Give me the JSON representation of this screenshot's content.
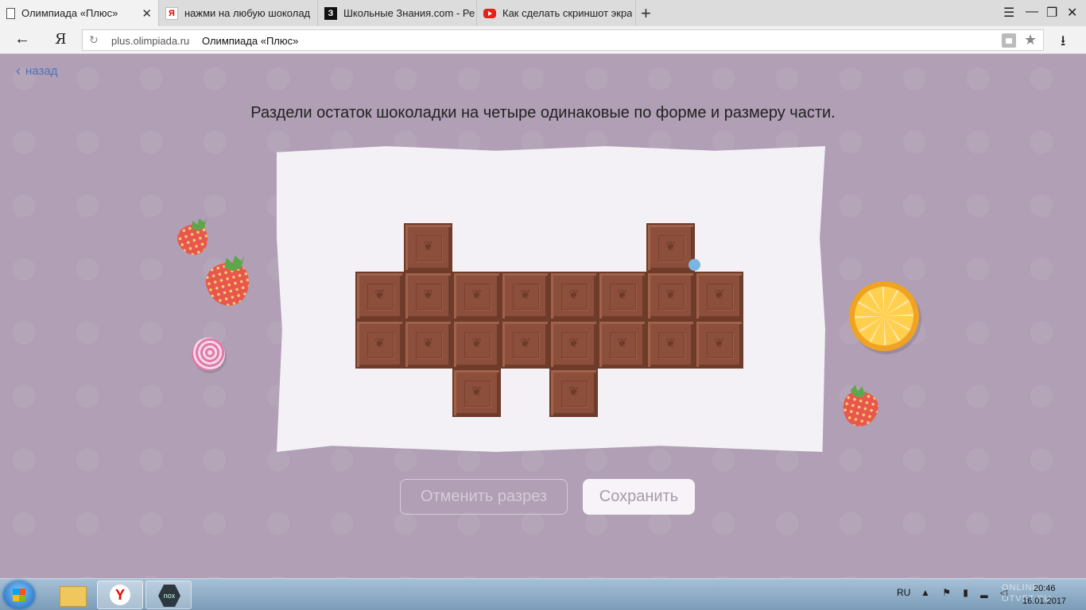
{
  "browser": {
    "tabs": [
      {
        "title": "Олимпиада «Плюс»",
        "favicon": "document-icon",
        "active": true
      },
      {
        "title": "нажми на любую шоколад",
        "favicon": "yandex-icon",
        "active": false
      },
      {
        "title": "Школьные Знания.com - Ре",
        "favicon": "znanija-icon",
        "active": false
      },
      {
        "title": "Как сделать скриншот экра",
        "favicon": "youtube-icon",
        "active": false
      }
    ],
    "new_tab_symbol": "+",
    "yandex_button": "Я",
    "url_domain": "plus.olimpiada.ru",
    "url_title": "Олимпиада «Плюс»"
  },
  "page": {
    "back_label": "назад",
    "instruction": "Раздели остаток шоколадки на четыре одинаковые по форме и размеру части.",
    "chocolate_grid": {
      "rows": [
        [
          0,
          1,
          0,
          0,
          0,
          0,
          1,
          0
        ],
        [
          1,
          1,
          1,
          1,
          1,
          1,
          1,
          1
        ],
        [
          1,
          1,
          1,
          1,
          1,
          1,
          1,
          1
        ],
        [
          0,
          0,
          1,
          0,
          1,
          0,
          0,
          0
        ]
      ],
      "piece_color": "#8b4f3b"
    },
    "buttons": {
      "undo_cut": "Отменить разрез",
      "save": "Сохранить"
    }
  },
  "taskbar": {
    "language": "RU",
    "time": "20:46",
    "date": "16.01.2017",
    "watermark": "ONLINE OTVET.RU"
  }
}
